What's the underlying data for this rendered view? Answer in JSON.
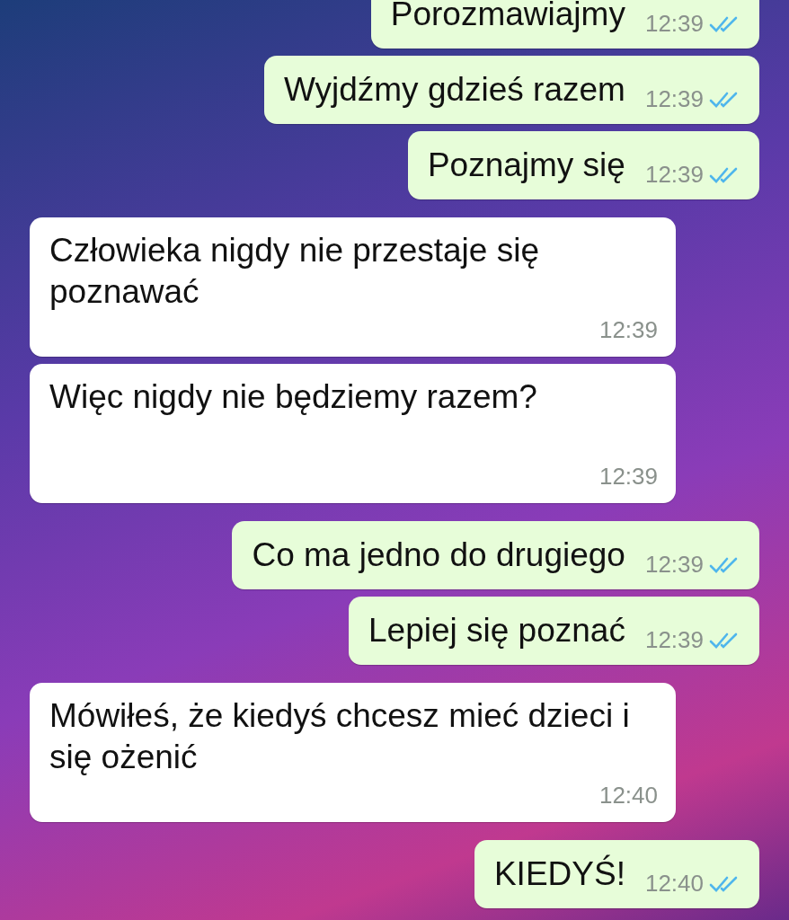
{
  "messages": [
    {
      "kind": "outgoing",
      "text": "Porozmawiajmy",
      "time": "12:39",
      "read": true
    },
    {
      "kind": "outgoing",
      "text": "Wyjdźmy gdzieś razem",
      "time": "12:39",
      "read": true
    },
    {
      "kind": "outgoing",
      "text": "Poznajmy się",
      "time": "12:39",
      "read": true
    },
    {
      "kind": "incoming",
      "text": "Człowieka nigdy nie przestaje się poznawać",
      "time": "12:39"
    },
    {
      "kind": "incoming",
      "text": "Więc nigdy nie będziemy razem?",
      "time": "12:39"
    },
    {
      "kind": "outgoing",
      "text": "Co ma jedno do drugiego",
      "time": "12:39",
      "read": true
    },
    {
      "kind": "outgoing",
      "text": "Lepiej się poznać",
      "time": "12:39",
      "read": true
    },
    {
      "kind": "incoming",
      "text": "Mówiłeś, że kiedyś chcesz mieć dzieci i się ożenić",
      "time": "12:40"
    },
    {
      "kind": "outgoing",
      "text": "KIEDYŚ!",
      "time": "12:40",
      "read": true
    }
  ]
}
